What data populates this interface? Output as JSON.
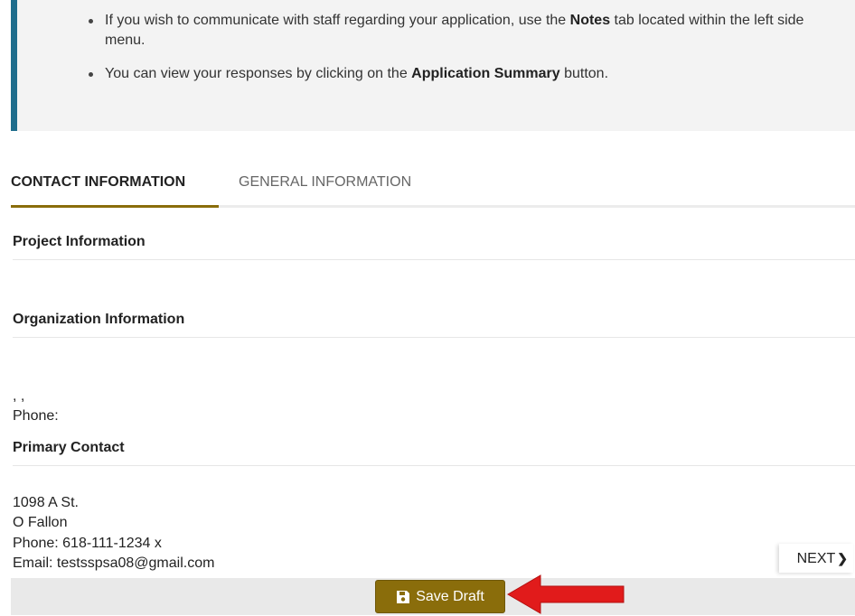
{
  "info": {
    "items": [
      {
        "before": "If you wish to communicate with staff regarding your application, use the ",
        "bold": "Notes",
        "after": " tab located within the left side menu."
      },
      {
        "before": "You can view your responses by clicking on the ",
        "bold": "Application Summary",
        "after": " button."
      }
    ]
  },
  "tabs": [
    {
      "label": "CONTACT INFORMATION",
      "active": true
    },
    {
      "label": "GENERAL INFORMATION",
      "active": false
    }
  ],
  "sections": {
    "project": {
      "title": "Project Information"
    },
    "organization": {
      "title": "Organization Information",
      "address_line": ", ,",
      "phone_line": "Phone:"
    },
    "primary_contact": {
      "title": "Primary Contact",
      "street": "1098 A St.",
      "city": "O Fallon",
      "phone": "Phone: 618-111-1234 x",
      "email": "Email: testsspsa08@gmail.com"
    }
  },
  "nav": {
    "next_label": "NEXT",
    "next_icon": "chevron-right-icon"
  },
  "footer": {
    "save_label": "Save Draft",
    "save_icon": "floppy-disk-icon"
  },
  "colors": {
    "accent": "#8a6d0b",
    "info_border": "#1f6d8c",
    "arrow": "#e11b1b"
  }
}
